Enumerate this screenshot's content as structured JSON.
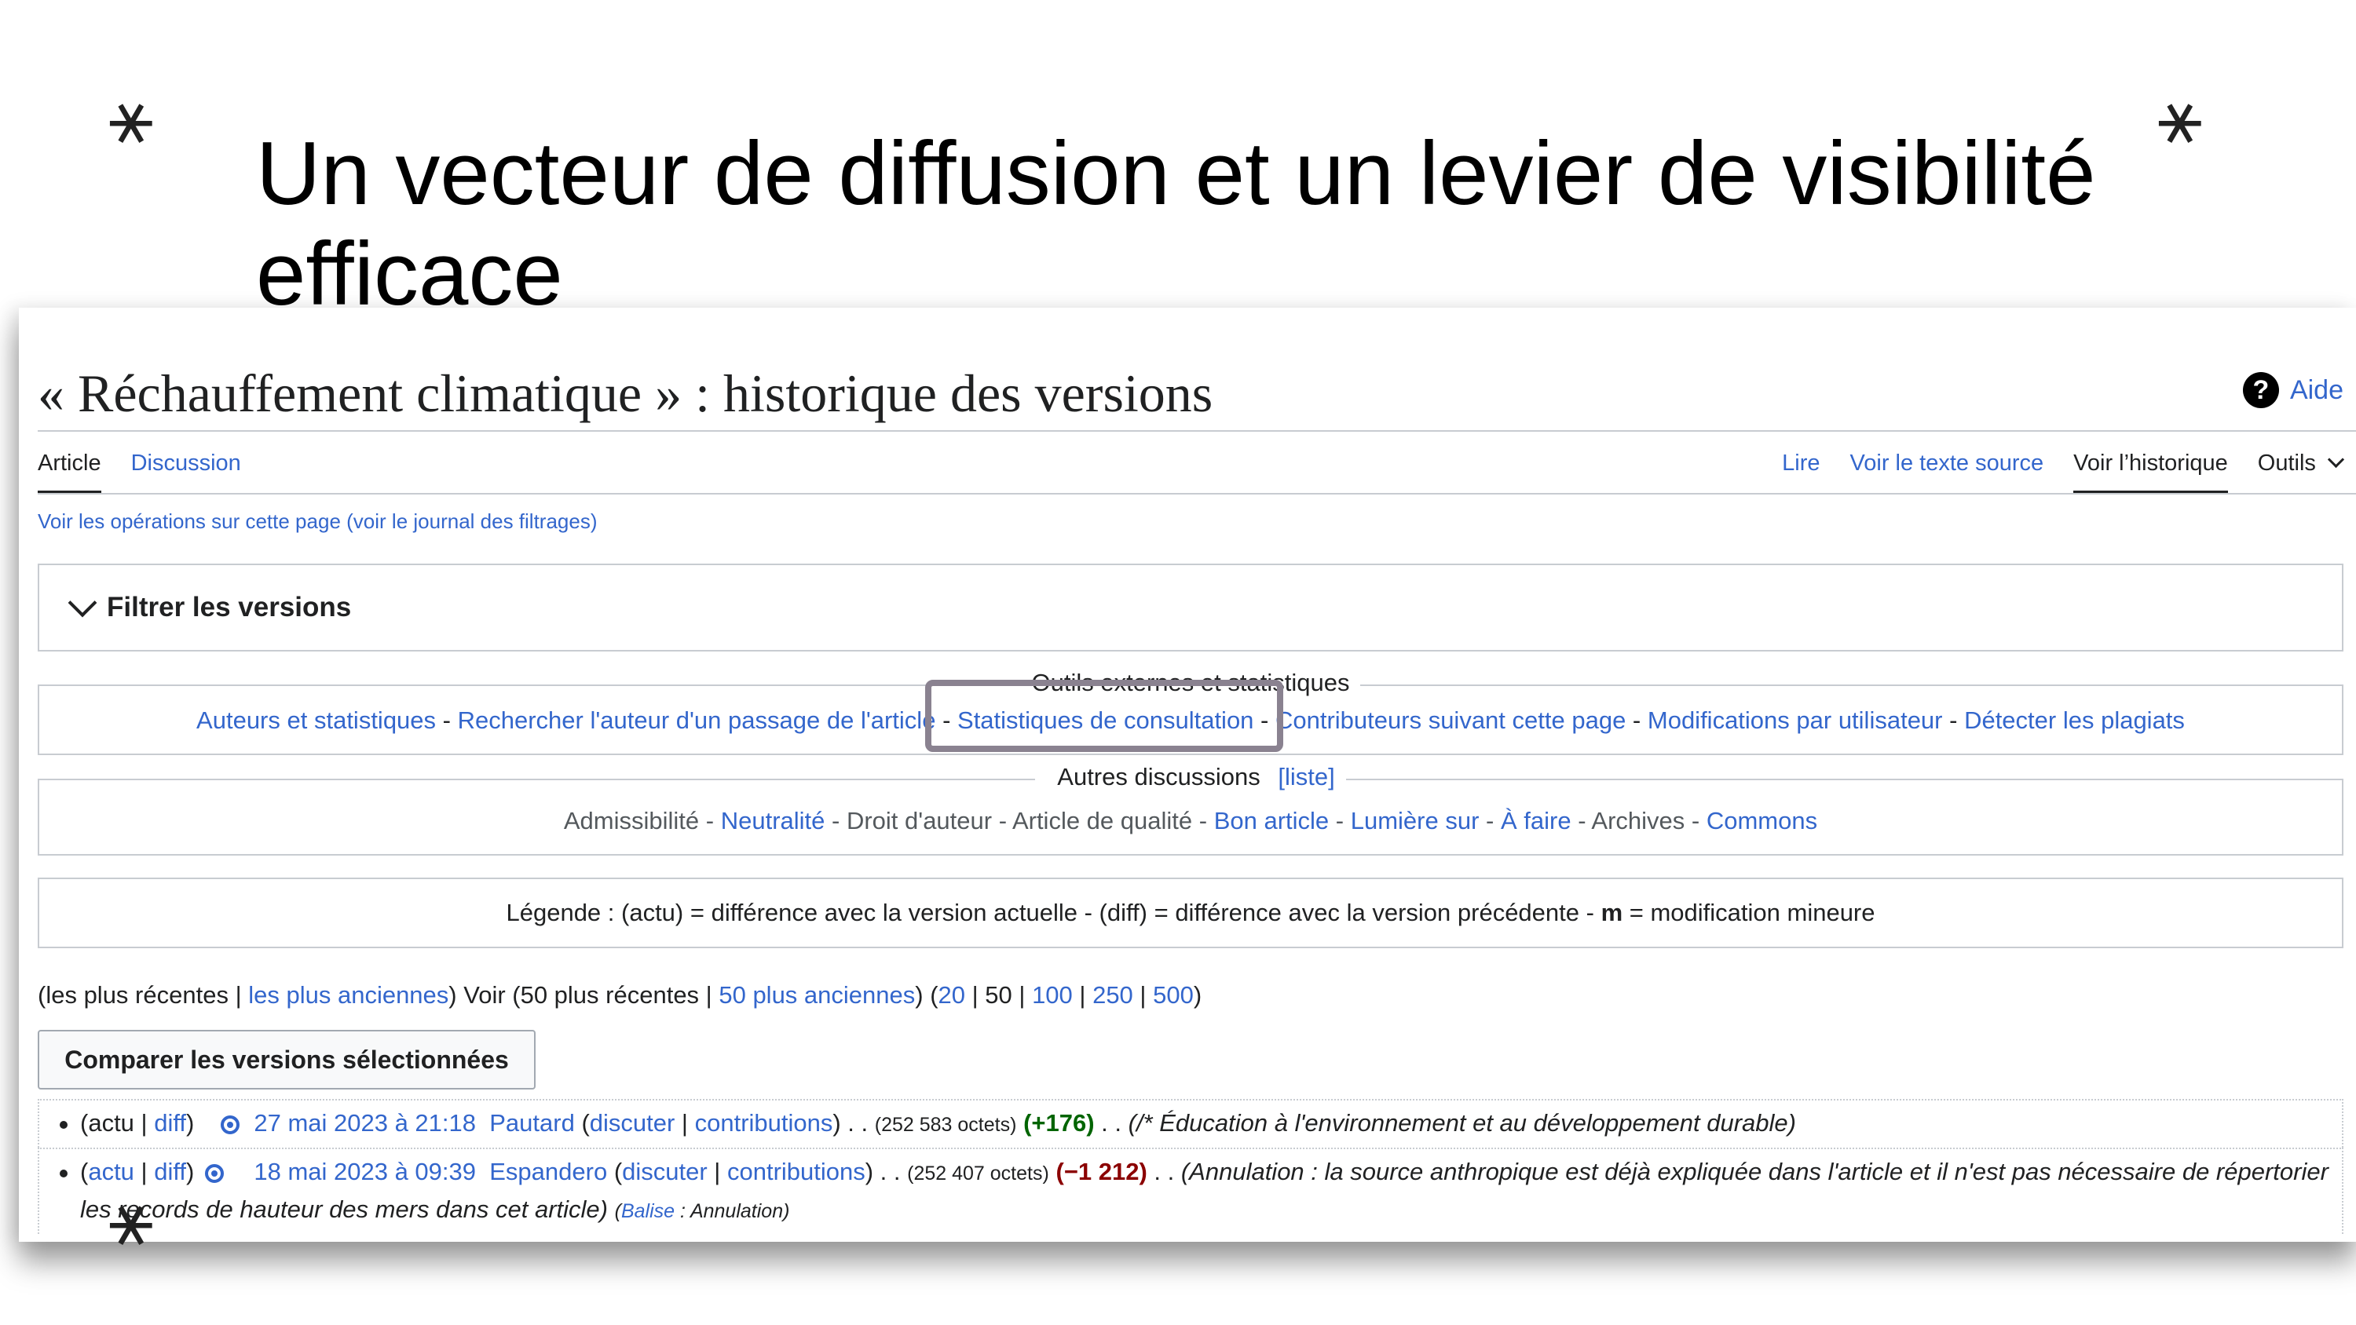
{
  "slide": {
    "title": "Un vecteur de diffusion et un levier de visibilité efficace",
    "decor_icon": "asterisk-star-icon"
  },
  "page": {
    "title": "« Réchauffement climatique » : historique des versions",
    "help_label": "Aide",
    "help_icon": "question-circle-icon"
  },
  "tabs": {
    "left": [
      "Article",
      "Discussion"
    ],
    "right": [
      "Lire",
      "Voir le texte source",
      "Voir l’historique",
      "Outils"
    ],
    "selected_left": "Article",
    "selected_right": "Voir l’historique"
  },
  "ops": {
    "link": "Voir les opérations sur cette page",
    "paren_open": " (",
    "journal": "voir le journal des filtrages",
    "paren_close": ")"
  },
  "filter": {
    "label": "Filtrer les versions"
  },
  "external": {
    "legend": "Outils externes et statistiques",
    "links": [
      "Auteurs et statistiques",
      "Rechercher l'auteur d'un passage de l'article",
      "Statistiques de consultation",
      "Contributeurs suivant cette page",
      "Modifications par utilisateur",
      "Détecter les plagiats"
    ],
    "highlighted": "Statistiques de consultation"
  },
  "discussions": {
    "legend": "Autres discussions",
    "legend_link": "[liste]",
    "items": [
      "Admissibilité",
      "Neutralité",
      "Droit d'auteur",
      "Article de qualité",
      "Bon article",
      "Lumière sur",
      "À faire",
      "Archives",
      "Commons"
    ]
  },
  "legend_line": {
    "text_a": "Légende : (actu) = différence avec la version actuelle - (diff) = différence avec la version précédente - ",
    "bold": "m",
    "text_b": " = modification mineure"
  },
  "nav": {
    "recent": "(les plus récentes",
    "older": "les plus anciennes",
    "voir": ") Voir (50 plus récentes",
    "older50": "50 plus anciennes",
    "counts": [
      "20",
      "50",
      "100",
      "250",
      "500"
    ]
  },
  "compare_button": "Comparer les versions sélectionnées",
  "history": [
    {
      "actu": "actu",
      "diff": "diff",
      "date": "27 mai 2023 à 21:18",
      "user": "Pautard",
      "talk": "discuter",
      "contribs": "contributions",
      "size": "(252 583 octets)",
      "delta": "(+176)",
      "comment": "(/* Éducation à l'environnement et au développement durable)"
    },
    {
      "actu": "actu",
      "diff": "diff",
      "date": "18 mai 2023 à 09:39",
      "user": "Espandero",
      "talk": "discuter",
      "contribs": "contributions",
      "size": "(252 407 octets)",
      "delta": "(−1 212)",
      "comment": "(Annulation : la source anthropique est déjà expliquée dans l'article et il n'est pas nécessaire de répertorier les records de hauteur des mers dans cet article)",
      "tag_link": "Balise",
      "tag_text": " : Annulation)"
    }
  ]
}
